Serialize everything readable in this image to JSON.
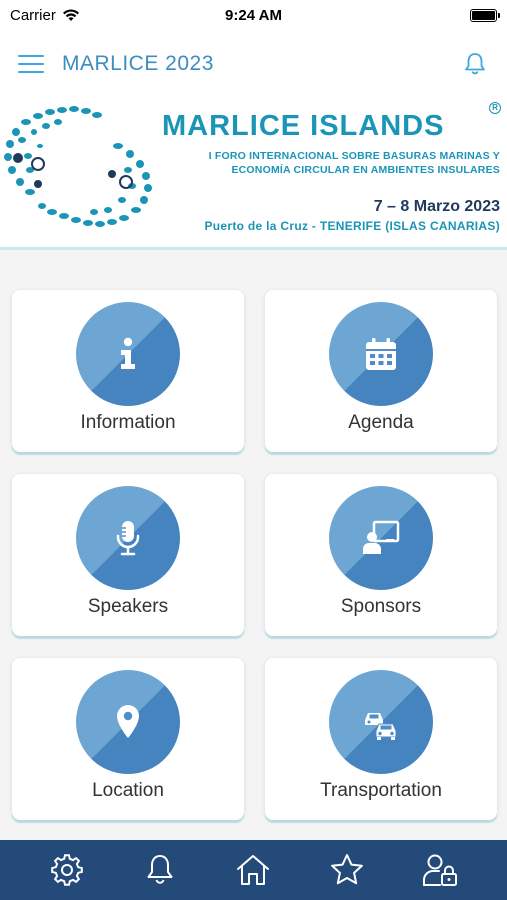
{
  "status_bar": {
    "carrier": "Carrier",
    "time": "9:24 AM"
  },
  "header": {
    "title": "MARLICE 2023",
    "menu_icon": "hamburger-menu-icon",
    "notification_icon": "bell-icon"
  },
  "banner": {
    "title": "MARLICE ISLANDS",
    "registered_mark": "R",
    "subtitle_line1": "I FORO INTERNACIONAL SOBRE BASURAS MARINAS Y",
    "subtitle_line2": "ECONOMÍA CIRCULAR EN AMBIENTES INSULARES",
    "date": "7 – 8 Marzo 2023",
    "place": "Puerto de la Cruz - TENERIFE (ISLAS CANARIAS)"
  },
  "tiles": [
    {
      "label": "Information",
      "icon": "info-icon"
    },
    {
      "label": "Agenda",
      "icon": "calendar-icon"
    },
    {
      "label": "Speakers",
      "icon": "microphone-icon"
    },
    {
      "label": "Sponsors",
      "icon": "presentation-icon"
    },
    {
      "label": "Location",
      "icon": "map-pin-icon"
    },
    {
      "label": "Transportation",
      "icon": "cars-icon"
    }
  ],
  "bottom_nav": [
    {
      "icon": "gear-icon"
    },
    {
      "icon": "bell-icon"
    },
    {
      "icon": "home-icon"
    },
    {
      "icon": "star-icon"
    },
    {
      "icon": "user-lock-icon"
    }
  ],
  "colors": {
    "header_text": "#3c8ec0",
    "banner_accent": "#1a95b6",
    "tile_circle_light": "#6ea6d3",
    "tile_circle_dark": "#4584be",
    "bottom_nav_bg": "#234a78"
  }
}
